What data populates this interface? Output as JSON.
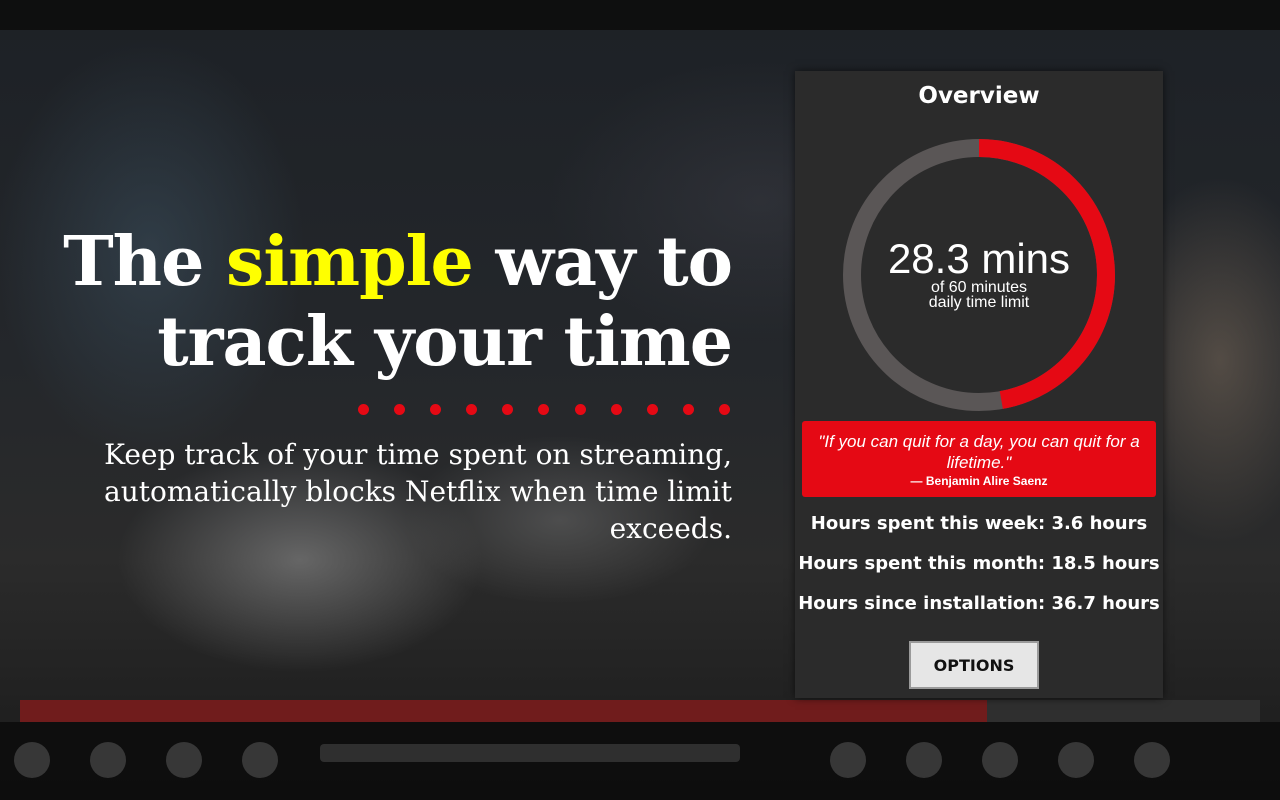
{
  "headline": {
    "before": "The ",
    "highlight": "simple",
    "after_line1": " way to",
    "line2": "track your time"
  },
  "subtitle": "Keep track of your time spent on streaming, automatically blocks Netflix when time limit exceeds.",
  "accent_color": "#e50914",
  "highlight_color": "#ffff00",
  "popup": {
    "title": "Overview",
    "usage": {
      "value_label": "28.3 mins",
      "caption_line1": "of 60 minutes",
      "caption_line2": "daily time limit",
      "used_minutes": 28.3,
      "limit_minutes": 60
    },
    "quote": {
      "text": "\"If you can quit for a day, you can quit for a lifetime.\"",
      "author": "— Benjamin Alire Saenz"
    },
    "stats": {
      "week": "Hours spent this week: 3.6 hours",
      "month": "Hours spent this month: 18.5 hours",
      "install": "Hours since installation: 36.7 hours"
    },
    "options_label": "OPTIONS"
  },
  "player": {
    "progress_fraction": 0.78
  }
}
